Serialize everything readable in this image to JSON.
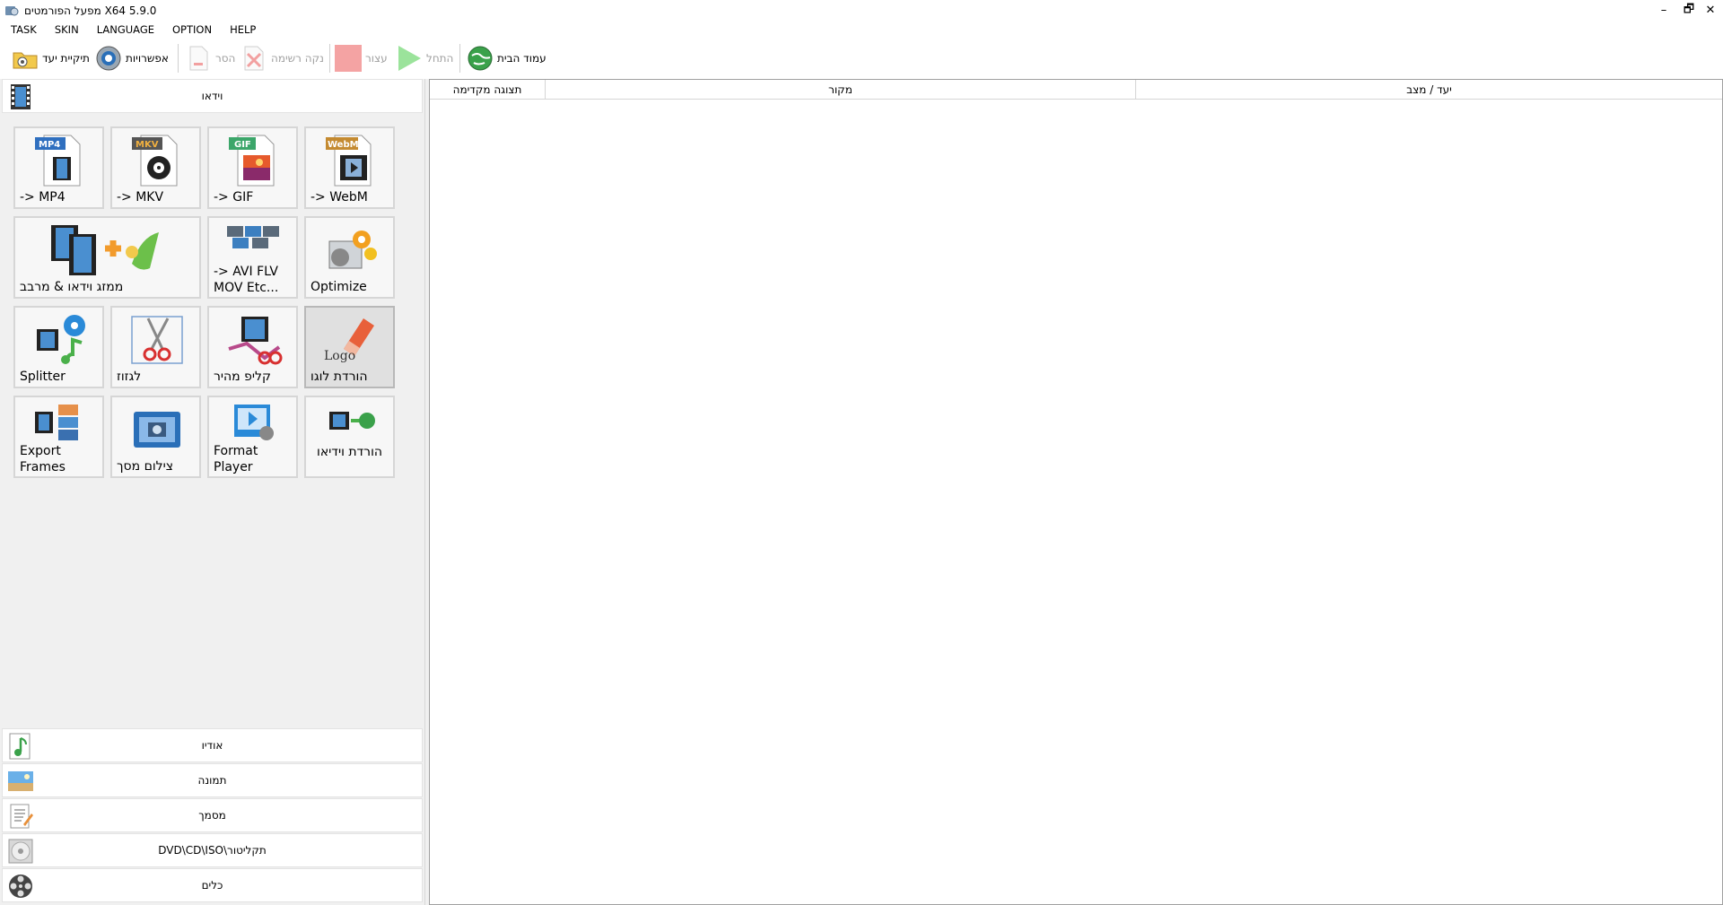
{
  "window": {
    "title": "מפעל הפורמטים X64 5.9.0",
    "controls": [
      "–",
      "🗗",
      "✕"
    ]
  },
  "menu": [
    "TASK",
    "SKIN",
    "LANGUAGE",
    "OPTION",
    "HELP"
  ],
  "toolbar": {
    "output_folder": "תיקיית יעד",
    "options": "אפשרויות",
    "remove": "הסר",
    "clear_list": "נקה רשימה",
    "stop": "עצור",
    "start": "התחל",
    "homepage": "עמוד הבית"
  },
  "categories": {
    "video": "וידאו",
    "audio": "אודיו",
    "picture": "תמונה",
    "document": "מסמך",
    "rom": "DVD\\CD\\ISO\\תקליטור",
    "utilities": "כלים"
  },
  "tiles": {
    "mp4": "-> MP4",
    "mkv": "-> MKV",
    "gif": "-> GIF",
    "webm": "-> WebM",
    "joiner": "ממזג וידאו & מרבב",
    "avi_line1": "-> AVI FLV",
    "avi_line2": "MOV Etc...",
    "optimize": "Optimize",
    "splitter": "Splitter",
    "crop": "לגזוז",
    "quick_clip": "קליפ מהיר",
    "logo_remover": "הורדת לוגו",
    "export_line1": "Export",
    "export_line2": "Frames",
    "screen_record": "צילום מסך",
    "player_line1": "Format",
    "player_line2": "Player",
    "video_download": "הורדת וידיאו"
  },
  "icon_text": {
    "mp4": "MP4",
    "mkv": "MKV",
    "gif": "GIF",
    "webm": "WebM",
    "logo": "Logo"
  },
  "list_columns": {
    "preview": "תצוגה מקדימה",
    "source": "מקור",
    "dest": "יעד / מצב"
  }
}
